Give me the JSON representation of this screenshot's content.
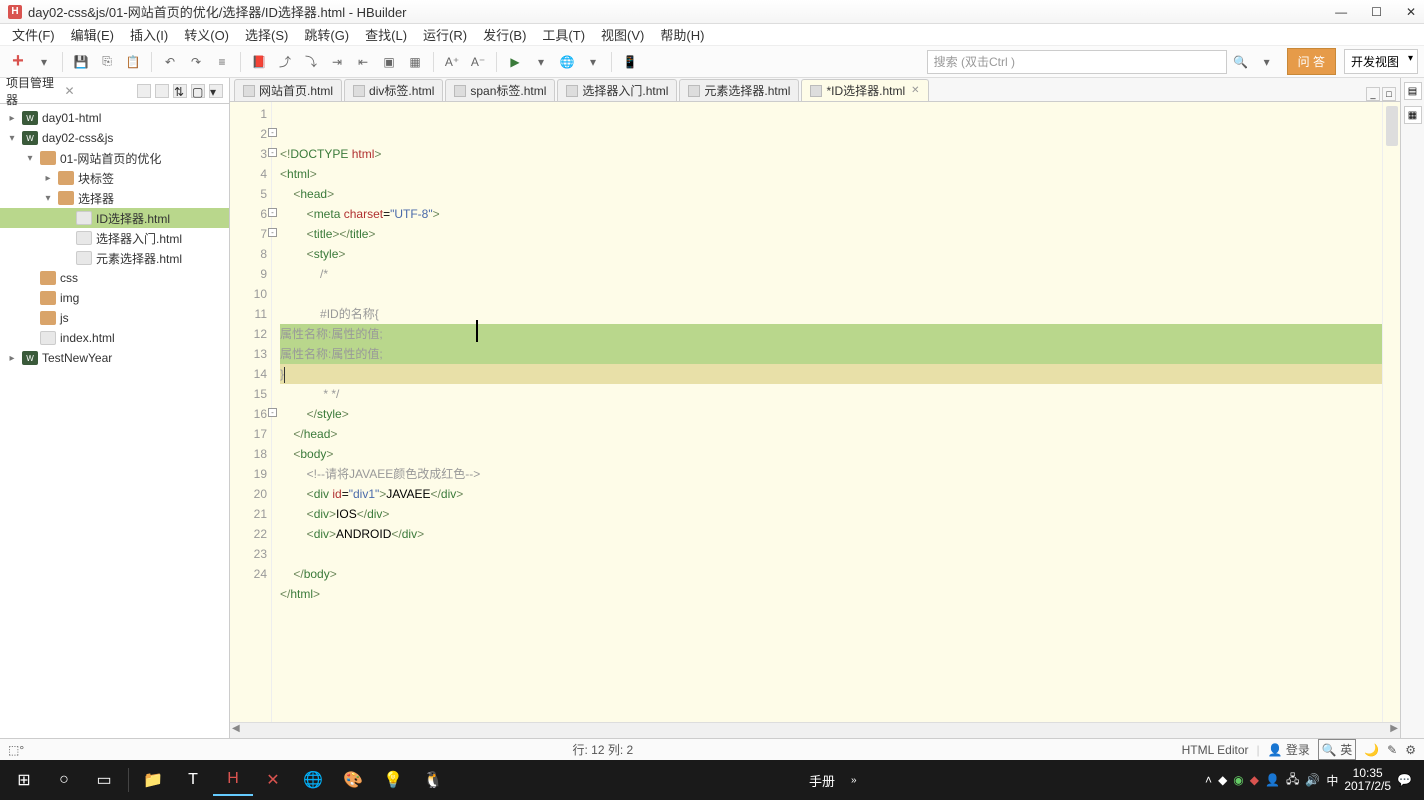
{
  "window": {
    "title": "day02-css&js/01-网站首页的优化/选择器/ID选择器.html - HBuilder"
  },
  "menus": [
    "文件(F)",
    "编辑(E)",
    "插入(I)",
    "转义(O)",
    "选择(S)",
    "跳转(G)",
    "查找(L)",
    "运行(R)",
    "发行(B)",
    "工具(T)",
    "视图(V)",
    "帮助(H)"
  ],
  "toolbar": {
    "search_placeholder": "搜索 (双击Ctrl )",
    "orange_btn": "问 答",
    "dev_view": "开发视图"
  },
  "sidebar": {
    "title": "项目管理器",
    "tree": [
      {
        "ind": 0,
        "arrow": "closed",
        "type": "proj",
        "label": "day01-html"
      },
      {
        "ind": 0,
        "arrow": "open",
        "type": "proj",
        "label": "day02-css&js"
      },
      {
        "ind": 1,
        "arrow": "open",
        "type": "folder",
        "label": "01-网站首页的优化"
      },
      {
        "ind": 2,
        "arrow": "closed",
        "type": "folder",
        "label": "块标签"
      },
      {
        "ind": 2,
        "arrow": "open",
        "type": "folder",
        "label": "选择器"
      },
      {
        "ind": 3,
        "arrow": "none",
        "type": "html",
        "label": "ID选择器.html",
        "sel": true
      },
      {
        "ind": 3,
        "arrow": "none",
        "type": "html",
        "label": "选择器入门.html"
      },
      {
        "ind": 3,
        "arrow": "none",
        "type": "html",
        "label": "元素选择器.html"
      },
      {
        "ind": 1,
        "arrow": "none",
        "type": "folder",
        "label": "css"
      },
      {
        "ind": 1,
        "arrow": "none",
        "type": "folder",
        "label": "img"
      },
      {
        "ind": 1,
        "arrow": "none",
        "type": "folder",
        "label": "js"
      },
      {
        "ind": 1,
        "arrow": "none",
        "type": "html",
        "label": "index.html"
      },
      {
        "ind": 0,
        "arrow": "closed",
        "type": "proj",
        "label": "TestNewYear"
      }
    ]
  },
  "tabs": [
    {
      "label": "网站首页.html"
    },
    {
      "label": "div标签.html"
    },
    {
      "label": "span标签.html"
    },
    {
      "label": "选择器入门.html"
    },
    {
      "label": "元素选择器.html"
    },
    {
      "label": "*ID选择器.html",
      "active": true
    }
  ],
  "code": {
    "lines": [
      {
        "n": 1,
        "html": "<span class='pn'>&lt;!</span><span class='tg'>DOCTYPE</span> <span class='at'>html</span><span class='pn'>&gt;</span>"
      },
      {
        "n": 2,
        "fold": "-",
        "html": "<span class='pn'>&lt;</span><span class='tg'>html</span><span class='pn'>&gt;</span>"
      },
      {
        "n": 3,
        "fold": "-",
        "html": "    <span class='pn'>&lt;</span><span class='tg'>head</span><span class='pn'>&gt;</span>"
      },
      {
        "n": 4,
        "html": "        <span class='pn'>&lt;</span><span class='tg'>meta</span> <span class='at'>charset</span>=<span class='st'>\"UTF-8\"</span><span class='pn'>&gt;</span>"
      },
      {
        "n": 5,
        "html": "        <span class='pn'>&lt;</span><span class='tg'>title</span><span class='pn'>&gt;&lt;/</span><span class='tg'>title</span><span class='pn'>&gt;</span>"
      },
      {
        "n": 6,
        "fold": "-",
        "html": "        <span class='pn'>&lt;</span><span class='tg'>style</span><span class='pn'>&gt;</span>"
      },
      {
        "n": 7,
        "fold": "-",
        "html": "            <span class='cm'>/*</span>"
      },
      {
        "n": 8,
        "html": ""
      },
      {
        "n": 9,
        "html": "            <span class='cm'>#ID的名称{</span>"
      },
      {
        "n": 10,
        "hl": "sel",
        "html": "<span class='cm'>属性名称:属性的值;</span>"
      },
      {
        "n": 11,
        "hl": "sel",
        "html": "<span class='cm'>属性名称:属性的值;</span>"
      },
      {
        "n": 12,
        "hl": "cur",
        "html": "<span class='cm'>}</span><span class='code-cursor'></span>"
      },
      {
        "n": 13,
        "html": "            <span class='cm'> * */</span>"
      },
      {
        "n": 14,
        "html": "        <span class='pn'>&lt;/</span><span class='tg'>style</span><span class='pn'>&gt;</span>"
      },
      {
        "n": 15,
        "html": "    <span class='pn'>&lt;/</span><span class='tg'>head</span><span class='pn'>&gt;</span>"
      },
      {
        "n": 16,
        "fold": "-",
        "html": "    <span class='pn'>&lt;</span><span class='tg'>body</span><span class='pn'>&gt;</span>"
      },
      {
        "n": 17,
        "html": "        <span class='cm'>&lt;!--请将JAVAEE颜色改成红色--&gt;</span>"
      },
      {
        "n": 18,
        "html": "        <span class='pn'>&lt;</span><span class='tg'>div</span> <span class='at'>id</span>=<span class='st'>\"div1\"</span><span class='pn'>&gt;</span>JAVAEE<span class='pn'>&lt;/</span><span class='tg'>div</span><span class='pn'>&gt;</span>"
      },
      {
        "n": 19,
        "html": "        <span class='pn'>&lt;</span><span class='tg'>div</span><span class='pn'>&gt;</span>IOS<span class='pn'>&lt;/</span><span class='tg'>div</span><span class='pn'>&gt;</span>"
      },
      {
        "n": 20,
        "html": "        <span class='pn'>&lt;</span><span class='tg'>div</span><span class='pn'>&gt;</span>ANDROID<span class='pn'>&lt;/</span><span class='tg'>div</span><span class='pn'>&gt;</span>"
      },
      {
        "n": 21,
        "html": ""
      },
      {
        "n": 22,
        "html": "    <span class='pn'>&lt;/</span><span class='tg'>body</span><span class='pn'>&gt;</span>"
      },
      {
        "n": 23,
        "html": "<span class='pn'>&lt;/</span><span class='tg'>html</span><span class='pn'>&gt;</span>"
      },
      {
        "n": 24,
        "html": ""
      }
    ]
  },
  "status": {
    "cursor_pos": "行: 12 列: 2",
    "editor": "HTML Editor",
    "login": "登录",
    "manual": "手册",
    "ime": "英"
  },
  "taskbar": {
    "time": "10:35",
    "date": "2017/2/5",
    "manual": "手册"
  }
}
